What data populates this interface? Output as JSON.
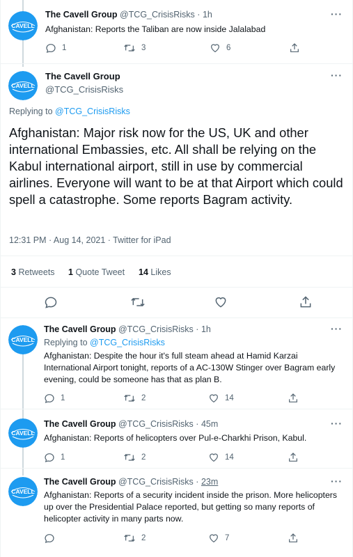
{
  "tweets_top": {
    "name": "The Cavell Group",
    "handle": "@TCG_CrisisRisks",
    "time": "1h",
    "text": "Afghanistan: Reports the Taliban are now inside Jalalabad",
    "replies": "1",
    "retweets": "3",
    "likes": "6"
  },
  "main_tweet": {
    "name": "The Cavell Group",
    "handle": "@TCG_CrisisRisks",
    "replying_prefix": "Replying to",
    "replying_to": "@TCG_CrisisRisks",
    "text": "Afghanistan: Major risk now for the US, UK and other international Embassies, etc. All shall be relying on the Kabul international airport, still in use by commercial airlines. Everyone will want to be at that Airport which could spell a catastrophe. Some reports Bagram activity.",
    "timestamp": "12:31 PM · Aug 14, 2021 · Twitter for iPad",
    "retweets_count": "3",
    "retweets_label": "Retweets",
    "quote_count": "1",
    "quote_label": "Quote Tweet",
    "likes_count": "14",
    "likes_label": "Likes"
  },
  "replies": [
    {
      "name": "The Cavell Group",
      "handle": "@TCG_CrisisRisks",
      "time": "1h",
      "replying_prefix": "Replying to",
      "replying_to": "@TCG_CrisisRisks",
      "text": "Afghanistan: Despite the hour it's full steam ahead at Hamid Karzai International Airport tonight, reports of a AC-130W Stinger over Bagram early evening, could be someone has that as plan B.",
      "replies": "1",
      "retweets": "2",
      "likes": "14"
    },
    {
      "name": "The Cavell Group",
      "handle": "@TCG_CrisisRisks",
      "time": "45m",
      "text": "Afghanistan: Reports of helicopters over Pul-e-Charkhi Prison, Kabul.",
      "replies": "1",
      "retweets": "2",
      "likes": "14"
    },
    {
      "name": "The Cavell Group",
      "handle": "@TCG_CrisisRisks",
      "time": "23m",
      "text": "Afghanistan: Reports of a security incident inside the prison. More helicopters up over the Presidential Palace reported, but getting so many reports of helicopter activity in many parts now.",
      "replies": "",
      "retweets": "2",
      "likes": "7"
    }
  ],
  "dot": "·",
  "more_glyph": "···",
  "avatar_text": "CAVELL",
  "icons": [
    "reply-icon",
    "retweet-icon",
    "like-icon",
    "share-icon",
    "more-icon"
  ],
  "colors": {
    "link": "#1d9bf0",
    "muted": "#536471",
    "text": "#0f1419",
    "avatar": "#1d9bf0"
  }
}
